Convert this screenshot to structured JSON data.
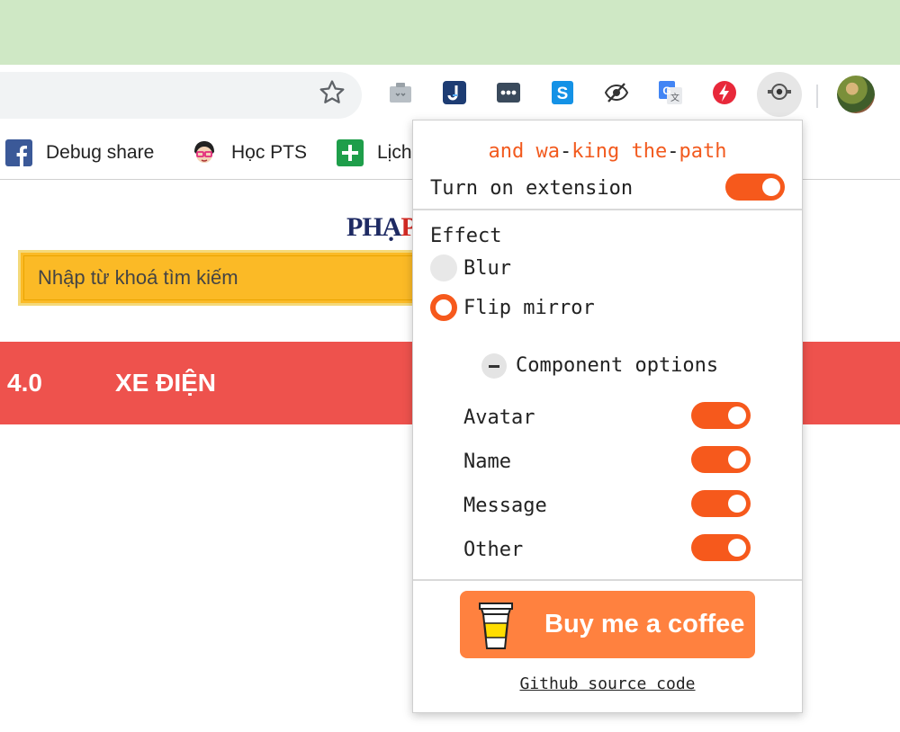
{
  "bookmarks": [
    {
      "label": "Debug share",
      "icon": "facebook-icon"
    },
    {
      "label": "Học PTS",
      "icon": "cartoon-face-icon"
    },
    {
      "label": "Lịch",
      "icon": "calendar-plus-icon"
    }
  ],
  "page": {
    "logo_text": "PHẠ",
    "logo_accent": "P",
    "search_placeholder": "Nhập từ khoá tìm kiếm",
    "nav": [
      "4.0",
      "XE ĐIỆN"
    ]
  },
  "popup": {
    "title_part1": "and wa",
    "title_sep1": "-",
    "title_part2": "king the",
    "title_sep2": "-",
    "title_part3": "path",
    "turn_on_label": "Turn on extension",
    "turn_on_enabled": true,
    "effect_label": "Effect",
    "effects": [
      {
        "label": "Blur",
        "selected": false
      },
      {
        "label": "Flip mirror",
        "selected": true
      }
    ],
    "component_options_label": "Component options",
    "components": [
      {
        "label": "Avatar",
        "enabled": true
      },
      {
        "label": "Name",
        "enabled": true
      },
      {
        "label": "Message",
        "enabled": true
      },
      {
        "label": "Other",
        "enabled": true
      }
    ],
    "coffee_label": "Buy me a coffee",
    "github_label": "Github source code"
  },
  "colors": {
    "accent": "#f6591c",
    "coffee": "#ff813f",
    "navbar": "#ee524d",
    "search": "#fbba26"
  }
}
